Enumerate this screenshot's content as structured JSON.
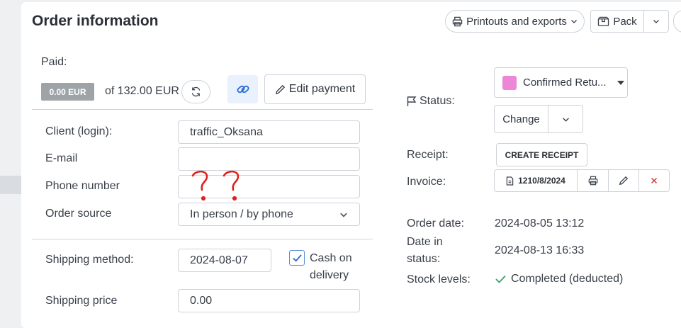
{
  "header": {
    "title": "Order information",
    "printouts_label": "Printouts and exports",
    "pack_label": "Pack"
  },
  "payment": {
    "paid_label": "Paid:",
    "paid_amount": "0.00 EUR",
    "total_text": "of 132.00 EUR",
    "edit_label": "Edit payment"
  },
  "form": {
    "client_label": "Client (login):",
    "client_value": "traffic_Oksana",
    "email_label": "E-mail",
    "email_value": "",
    "phone_label": "Phone number",
    "phone_value": "",
    "source_label": "Order source",
    "source_value": "In person / by phone",
    "shipping_label": "Shipping method:",
    "shipping_value": "2024-08-07",
    "cod_line1": "Cash on",
    "cod_line2": "delivery",
    "cod_checked": true,
    "shipping_price_label": "Shipping price",
    "shipping_price_value": "0.00"
  },
  "status": {
    "label": "Status:",
    "value": "Confirmed Retu...",
    "color": "#ec86d6",
    "change_label": "Change"
  },
  "documents": {
    "receipt_label": "Receipt:",
    "create_receipt_label": "CREATE RECEIPT",
    "invoice_label": "Invoice:",
    "invoice_number": "1210/8/2024"
  },
  "details": {
    "order_date_label": "Order date:",
    "order_date_value": "2024-08-05 13:12",
    "date_in_status_line1": "Date in",
    "date_in_status_line2": "status:",
    "date_in_status_value": "2024-08-13 16:33",
    "stock_label": "Stock levels:",
    "stock_value": "Completed (deducted)"
  },
  "annotation": {
    "handwritten_marks": "? ?"
  }
}
